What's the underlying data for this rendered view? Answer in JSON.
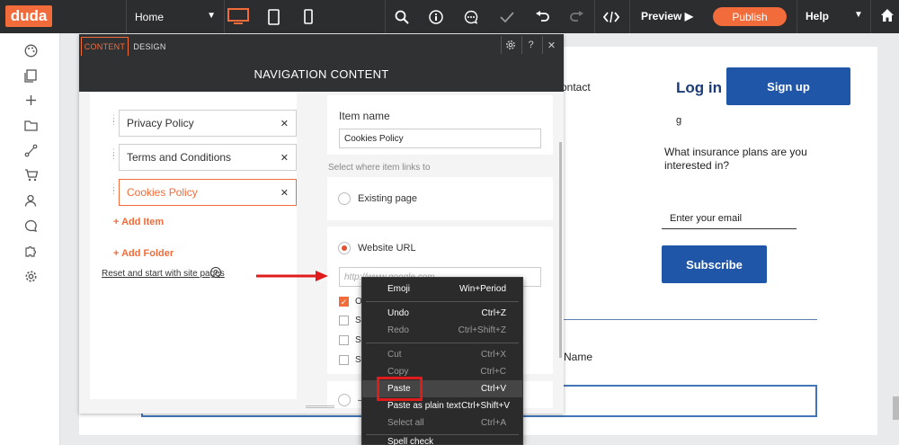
{
  "topbar": {
    "logo": "duda",
    "page_select": "Home",
    "preview": "Preview",
    "publish": "Publish",
    "help": "Help",
    "accent": "#f26b3a"
  },
  "sidebar_icons": [
    "palette-icon",
    "pages-icon",
    "plus-icon",
    "folder-icon",
    "flow-icon",
    "cart-icon",
    "user-icon",
    "chat-icon",
    "puzzle-icon",
    "gear-icon"
  ],
  "panel": {
    "tab_content": "CONTENT",
    "tab_design": "DESIGN",
    "title": "NAVIGATION CONTENT",
    "nav_items": [
      {
        "label": "Privacy Policy"
      },
      {
        "label": "Terms and Conditions"
      },
      {
        "label": "Cookies Policy",
        "selected": true
      }
    ],
    "add_item": "Add Item",
    "add_folder": "Add Folder",
    "reset_link": "Reset and start with site pages",
    "item_name_label": "Item name",
    "item_name_value": "Cookies Policy",
    "link_section_label": "Select where item links to",
    "option_existing": "Existing page",
    "option_url": "Website URL",
    "url_placeholder": "http://www.google.com",
    "checkbox_prefixes": [
      "O",
      "S",
      "S",
      "S"
    ],
    "bottom_radio_prefix": "—"
  },
  "site": {
    "contact": "ontact",
    "login": "Log in",
    "signup": "Sign up",
    "tick": "g",
    "question": "What insurance plans are you interested in?",
    "email_placeholder": "Enter your email",
    "subscribe": "Subscribe",
    "name_label": "Name"
  },
  "context_menu": {
    "items": [
      {
        "label": "Emoji",
        "shortcut": "Win+Period",
        "enabled": true
      },
      {
        "label": "Undo",
        "shortcut": "Ctrl+Z",
        "enabled": true
      },
      {
        "label": "Redo",
        "shortcut": "Ctrl+Shift+Z",
        "enabled": false
      },
      {
        "label": "Cut",
        "shortcut": "Ctrl+X",
        "enabled": false
      },
      {
        "label": "Copy",
        "shortcut": "Ctrl+C",
        "enabled": false
      },
      {
        "label": "Paste",
        "shortcut": "Ctrl+V",
        "enabled": true,
        "highlighted": true
      },
      {
        "label": "Paste as plain text",
        "shortcut": "Ctrl+Shift+V",
        "enabled": true
      },
      {
        "label": "Select all",
        "shortcut": "Ctrl+A",
        "enabled": false
      },
      {
        "label": "Spell check",
        "shortcut": "",
        "enabled": true
      }
    ]
  }
}
